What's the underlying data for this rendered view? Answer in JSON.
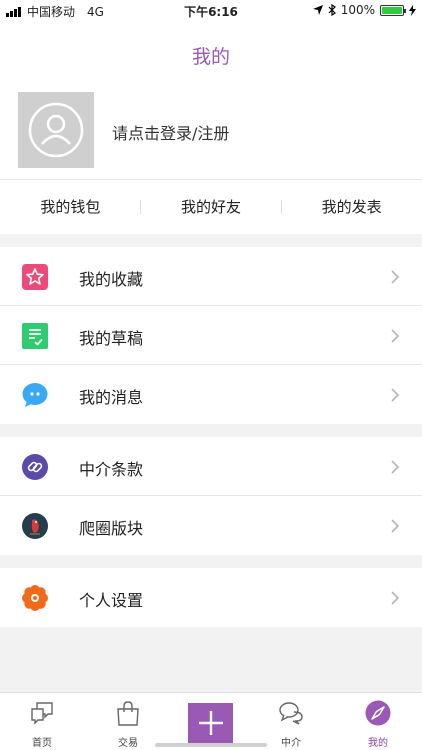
{
  "status": {
    "carrier": "中国移动",
    "network": "4G",
    "time": "下午6:16",
    "battery": "100%",
    "battery_level": 1.0
  },
  "header": {
    "title": "我的"
  },
  "profile": {
    "login_text": "请点击登录/注册"
  },
  "quick_links": [
    "我的钱包",
    "我的好友",
    "我的发表"
  ],
  "menu": {
    "group1": [
      {
        "label": "我的收藏",
        "icon": "star-icon",
        "color": "#ec4a7b"
      },
      {
        "label": "我的草稿",
        "icon": "draft-icon",
        "color": "#2ecc71"
      },
      {
        "label": "我的消息",
        "icon": "chat-bubble-icon",
        "color": "#3aa9f5"
      }
    ],
    "group2": [
      {
        "label": "中介条款",
        "icon": "link-icon",
        "color": "#5b4aa8"
      },
      {
        "label": "爬圈版块",
        "icon": "parrot-icon",
        "color": "#263d4d"
      }
    ],
    "group3": [
      {
        "label": "个人设置",
        "icon": "flower-settings-icon",
        "color": "#f06a1a"
      }
    ]
  },
  "tabbar": [
    {
      "label": "首页",
      "icon": "home-chat-icon"
    },
    {
      "label": "交易",
      "icon": "shopping-bag-icon"
    },
    {
      "label": "",
      "icon": "plus-icon"
    },
    {
      "label": "中介",
      "icon": "messages-icon"
    },
    {
      "label": "我的",
      "icon": "compass-icon",
      "active": true
    }
  ],
  "colors": {
    "accent": "#9b59b6",
    "background": "#f2f2f2"
  }
}
